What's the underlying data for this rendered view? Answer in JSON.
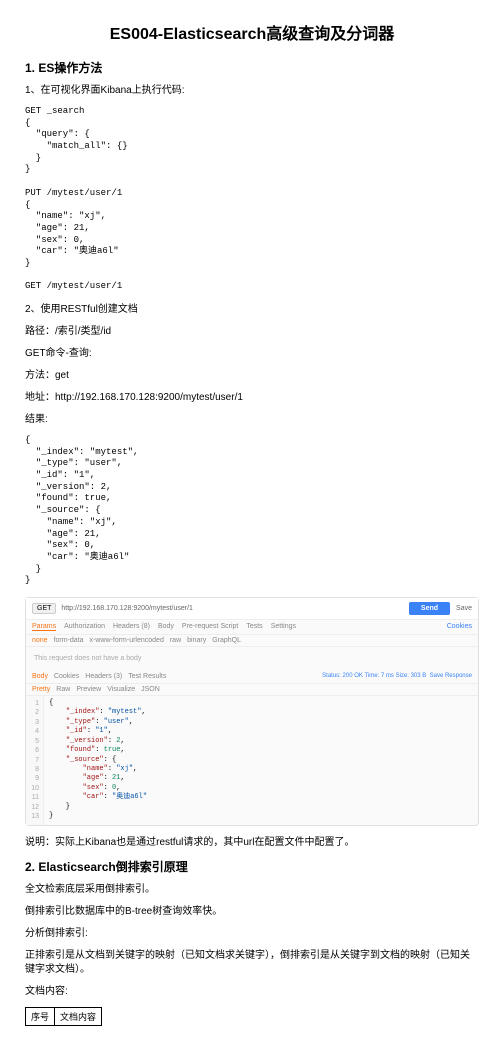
{
  "title": "ES004-Elasticsearch高级查询及分词器",
  "s1": {
    "heading": "1. ES操作方法",
    "p1": "1、在可视化界面Kibana上执行代码:",
    "code1": "GET _search\n{\n  \"query\": {\n    \"match_all\": {}\n  }\n}\n\nPUT /mytest/user/1\n{\n  \"name\": \"xj\",\n  \"age\": 21,\n  \"sex\": 0,\n  \"car\": \"奥迪a6l\"\n}\n\nGET /mytest/user/1",
    "p2": "2、使用RESTful创建文档",
    "p3": "路径：/索引/类型/id",
    "p4": "GET命令-查询:",
    "p5": "方法：get",
    "p6": "地址：http://192.168.170.128:9200/mytest/user/1",
    "p7": "结果:",
    "code2": "{\n  \"_index\": \"mytest\",\n  \"_type\": \"user\",\n  \"_id\": \"1\",\n  \"_version\": 2,\n  \"found\": true,\n  \"_source\": {\n    \"name\": \"xj\",\n    \"age\": 21,\n    \"sex\": 0,\n    \"car\": \"奥迪a6l\"\n  }\n}",
    "p8": "说明：实际上Kibana也是通过restful请求的，其中url在配置文件中配置了。"
  },
  "postman": {
    "method": "GET",
    "url": "http://192.168.170.128:9200/mytest/user/1",
    "send": "Send",
    "save": "Save",
    "tabs": [
      "Params",
      "Authorization",
      "Headers (8)",
      "Body",
      "Pre-request Script",
      "Tests",
      "Settings"
    ],
    "cookies": "Cookies",
    "sub": [
      "none",
      "form-data",
      "x-www-form-urlencoded",
      "raw",
      "binary",
      "GraphQL"
    ],
    "respTabs": [
      "Body",
      "Cookies",
      "Headers (3)",
      "Test Results"
    ],
    "status": {
      "s": "Status:",
      "code": "200 OK",
      "t": "Time:",
      "tv": "7 ms",
      "sz": "Size:",
      "szv": "303 B"
    },
    "saveResp": "Save Response",
    "viewTabs": [
      "Pretty",
      "Raw",
      "Preview",
      "Visualize"
    ],
    "fmt": "JSON",
    "json": [
      {
        "l": 1,
        "t": "{"
      },
      {
        "l": 2,
        "t": "    \"_index\": \"mytest\","
      },
      {
        "l": 3,
        "t": "    \"_type\": \"user\","
      },
      {
        "l": 4,
        "t": "    \"_id\": \"1\","
      },
      {
        "l": 5,
        "t": "    \"_version\": 2,"
      },
      {
        "l": 6,
        "t": "    \"found\": true,"
      },
      {
        "l": 7,
        "t": "    \"_source\": {"
      },
      {
        "l": 8,
        "t": "        \"name\": \"xj\","
      },
      {
        "l": 9,
        "t": "        \"age\": 21,"
      },
      {
        "l": 10,
        "t": "        \"sex\": 0,"
      },
      {
        "l": 11,
        "t": "        \"car\": \"奥迪a6l\""
      },
      {
        "l": 12,
        "t": "    }"
      },
      {
        "l": 13,
        "t": "}"
      }
    ]
  },
  "s2": {
    "heading": "2. Elasticsearch倒排索引原理",
    "p1": "全文检索底层采用倒排索引。",
    "p2": "倒排索引比数据库中的B-tree树查询效率快。",
    "p3": "分析倒排索引:",
    "p4": "正排索引是从文档到关键字的映射（已知文档求关键字），倒排索引是从关键字到文档的映射（已知关键字求文档）。",
    "p5": "文档内容:"
  },
  "table": {
    "h1": "序号",
    "h2": "文档内容"
  }
}
